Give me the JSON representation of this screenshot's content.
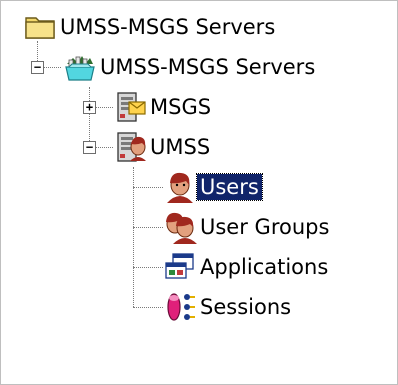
{
  "tree": {
    "root": {
      "label": "UMSS-MSGS Servers",
      "icon": "folder-icon"
    },
    "group": {
      "label": "UMSS-MSGS Servers",
      "icon": "server-group-icon",
      "expander": "−"
    },
    "msgs": {
      "label": "MSGS",
      "icon": "msgs-server-icon",
      "expander": "+"
    },
    "umss": {
      "label": "UMSS",
      "icon": "umss-server-icon",
      "expander": "−"
    },
    "children": [
      {
        "label": "Users",
        "icon": "users-icon",
        "selected": true
      },
      {
        "label": "User Groups",
        "icon": "user-groups-icon",
        "selected": false
      },
      {
        "label": "Applications",
        "icon": "applications-icon",
        "selected": false
      },
      {
        "label": "Sessions",
        "icon": "sessions-icon",
        "selected": false
      }
    ]
  },
  "colors": {
    "selection": "#10246a",
    "folder": "#f2d76b"
  }
}
